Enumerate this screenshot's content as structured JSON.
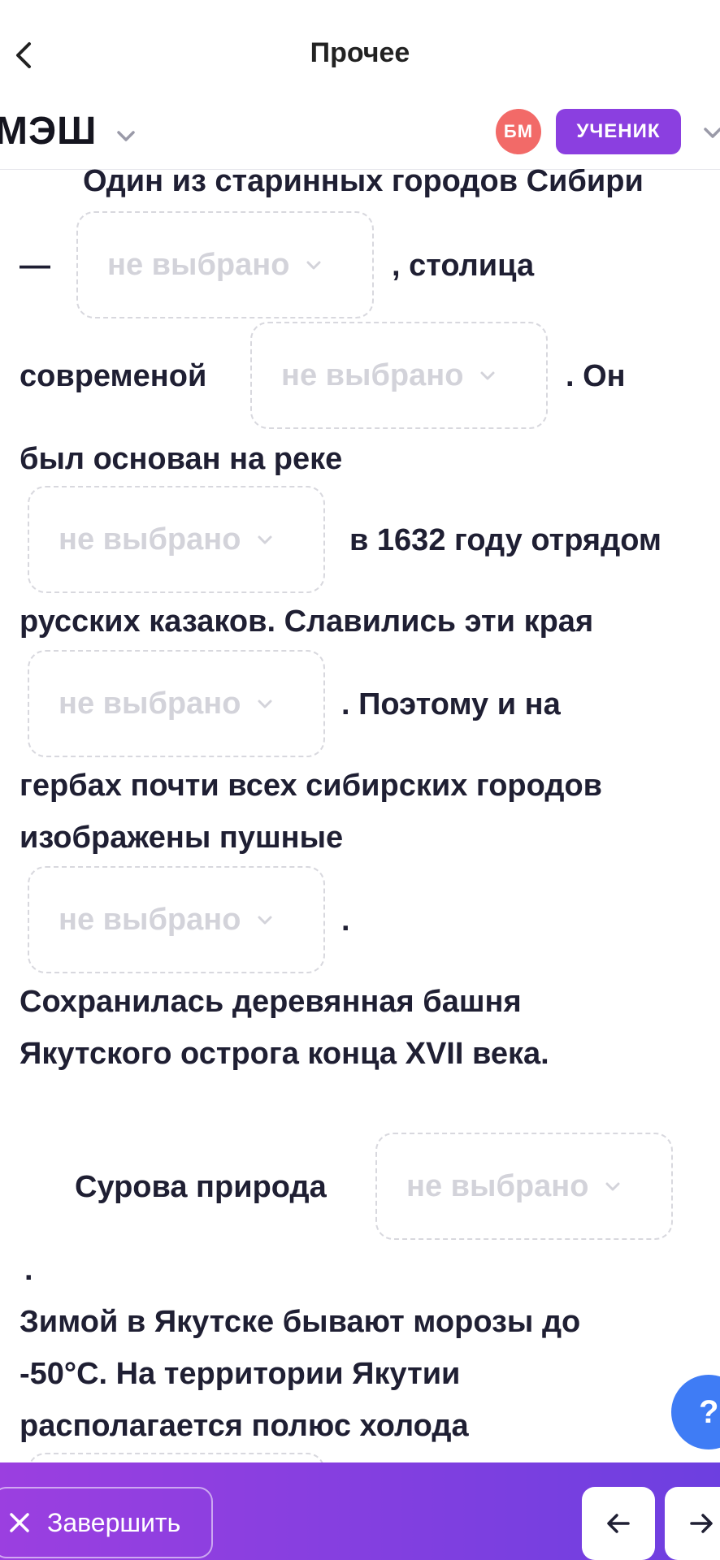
{
  "header": {
    "title": "Прочее",
    "logo": "МЭШ",
    "avatar_initials": "БМ",
    "role": "УЧЕНИК"
  },
  "text": {
    "p1": "Один из старинных городов Сибири",
    "p2": "—",
    "p3": ", столица",
    "p4": "современой",
    "p5": ". Он",
    "p6": "был основан на реке",
    "p7": "в 1632 году отрядом",
    "p8": "русских казаков. Славились эти края",
    "p9": ". Поэтому и на",
    "p10": "гербах почти всех сибирских городов",
    "p11": "изображены пушные",
    "p12": ".",
    "p13": "Сохранилась деревянная башня",
    "p14": "Якутского острога конца XVII века.",
    "p15": "Сурова природа",
    "p16": ".",
    "p17": "Зимой в Якутске бывают морозы до",
    "p18": "-50°С. На территории Якутии",
    "p19": "располагается полюс холода"
  },
  "dropdowns": [
    {
      "label": "не выбрано"
    },
    {
      "label": "не выбрано"
    },
    {
      "label": "не выбрано"
    },
    {
      "label": "не выбрано"
    },
    {
      "label": "не выбрано"
    },
    {
      "label": "не выбрано"
    }
  ],
  "help_fab": {
    "label": "?"
  },
  "bottom": {
    "finish_label": "Завершить"
  },
  "colors": {
    "accent": "#8b3fe0",
    "avatar": "#f26a68",
    "help": "#3f7cf5"
  }
}
